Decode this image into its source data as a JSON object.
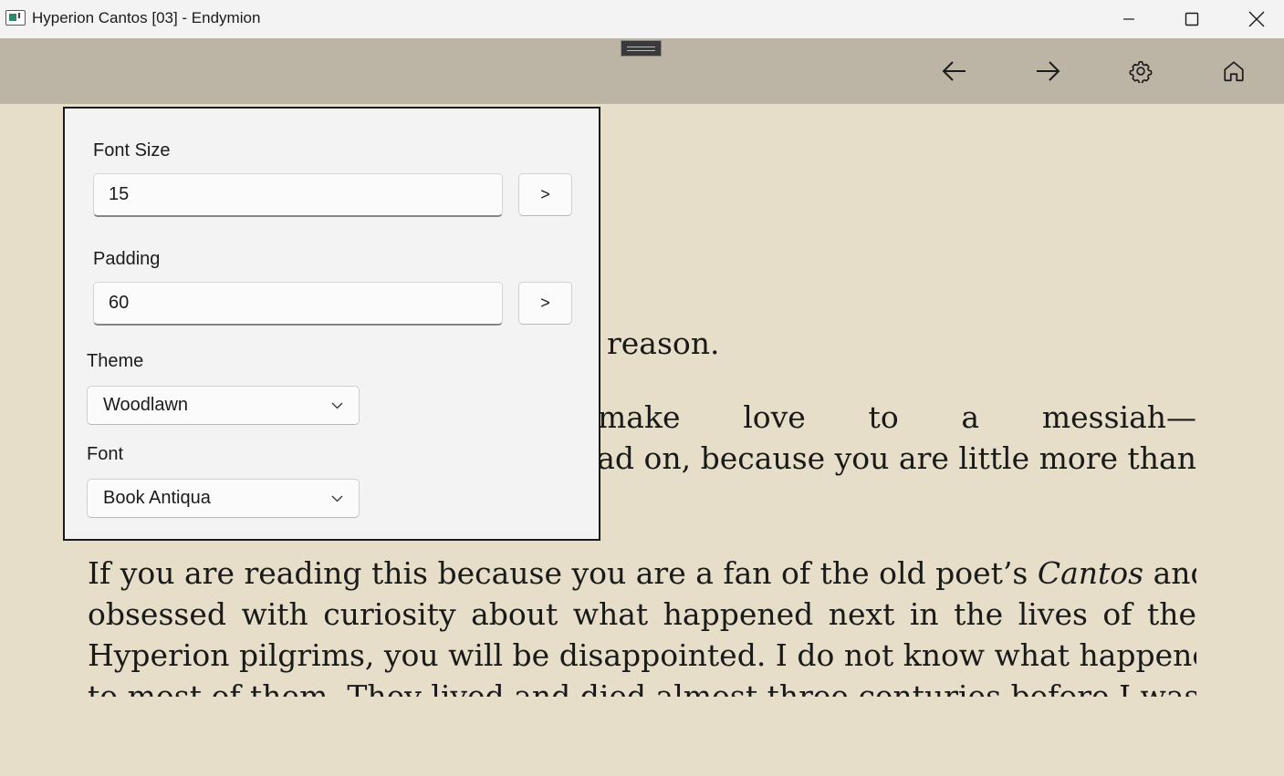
{
  "window": {
    "title": "Hyperion Cantos [03] - Endymion"
  },
  "toolbar": {
    "icons": [
      "arrow-left-icon",
      "arrow-right-icon",
      "gear-icon",
      "home-icon"
    ]
  },
  "settings": {
    "font_size_label": "Font Size",
    "font_size_value": "15",
    "padding_label": "Padding",
    "padding_value": "60",
    "apply_label": ">",
    "theme_label": "Theme",
    "theme_value": "Woodlawn",
    "font_label": "Font",
    "font_value": "Book Antiqua"
  },
  "reader": {
    "visible_fragments": [
      "reason.",
      "at it was like to make love to a messiah—",
      "read on, because you are little more than"
    ],
    "paragraph_lines": [
      {
        "before": "If you are reading this because you are a fan of the old poet’s ",
        "italic": "Cantos",
        "after": " and are"
      },
      {
        "text": "obsessed with curiosity about what happened next in the lives of the"
      },
      {
        "text": "Hyperion pilgrims, you will be disappointed. I do not know what happened"
      },
      {
        "text": "to most of them. They lived and died almost three centuries before I was"
      }
    ]
  }
}
